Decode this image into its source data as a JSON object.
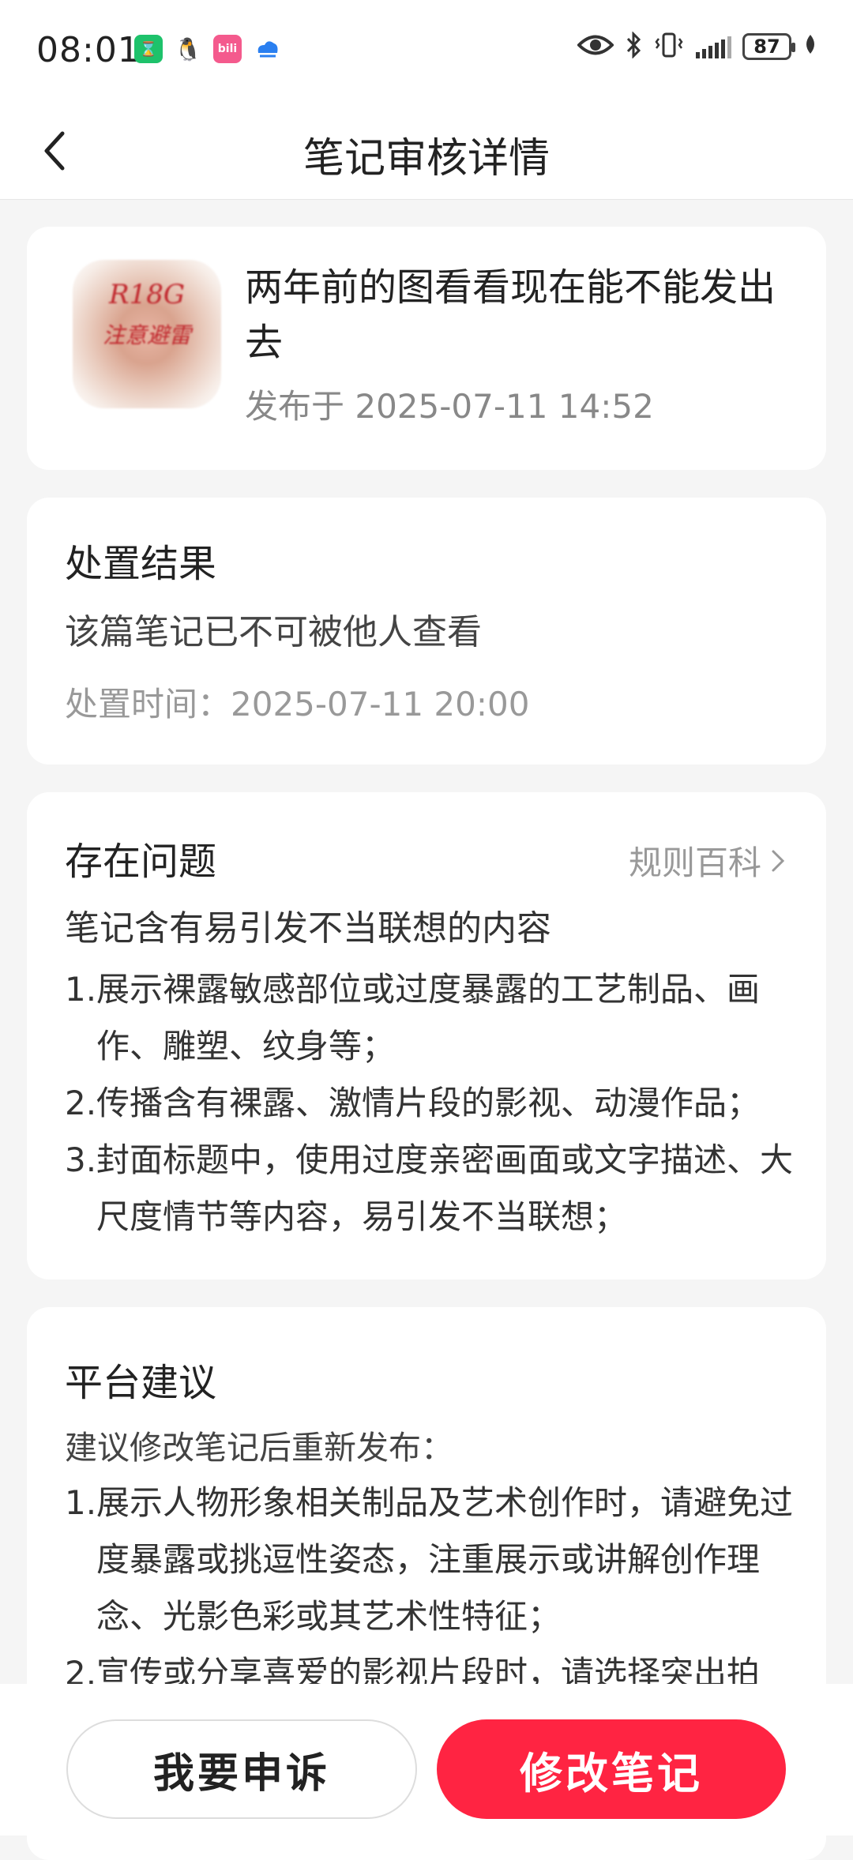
{
  "status_bar": {
    "time": "08:01",
    "battery": "87",
    "app_icons": [
      "hourglass-app-icon",
      "qq-penguin-icon",
      "bilibili-icon",
      "cloud-app-icon"
    ],
    "right_icons": [
      "eye-icon",
      "bluetooth-icon",
      "vibrate-icon",
      "signal-icon",
      "battery-icon",
      "leaf-icon"
    ]
  },
  "header": {
    "title": "笔记审核详情"
  },
  "note": {
    "thumbnail_text_line1": "R18G",
    "thumbnail_text_line2": "注意避雷",
    "title": "两年前的图看看现在能不能发出去",
    "published": "发布于 2025-07-11 14:52"
  },
  "result": {
    "heading": "处置结果",
    "text": "该篇笔记已不可被他人查看",
    "time": "处置时间：2025-07-11 20:00"
  },
  "problem": {
    "heading": "存在问题",
    "rule_link": "规则百科",
    "summary": "笔记含有易引发不当联想的内容",
    "items": [
      {
        "num": "1.",
        "text": "展示裸露敏感部位或过度暴露的工艺制品、画作、雕塑、纹身等；"
      },
      {
        "num": "2.",
        "text": "传播含有裸露、激情片段的影视、动漫作品；"
      },
      {
        "num": "3.",
        "text": "封面标题中，使用过度亲密画面或文字描述、大尺度情节等内容，易引发不当联想；"
      }
    ]
  },
  "advice": {
    "heading": "平台建议",
    "intro": "建议修改笔记后重新发布：",
    "items": [
      {
        "num": "1.",
        "text": "展示人物形象相关制品及艺术创作时，请避免过度暴露或挑逗性姿态，注重展示或讲解创作理念、光影色彩或其艺术性特征；"
      },
      {
        "num": "2.",
        "text": "宣传或分享喜爱的影视片段时，请选择突出拍"
      }
    ]
  },
  "actions": {
    "appeal": "我要申诉",
    "edit": "修改笔记"
  },
  "colors": {
    "accent": "#ff2442",
    "background": "#f5f5f5",
    "card": "#ffffff",
    "muted_text": "#999999"
  }
}
